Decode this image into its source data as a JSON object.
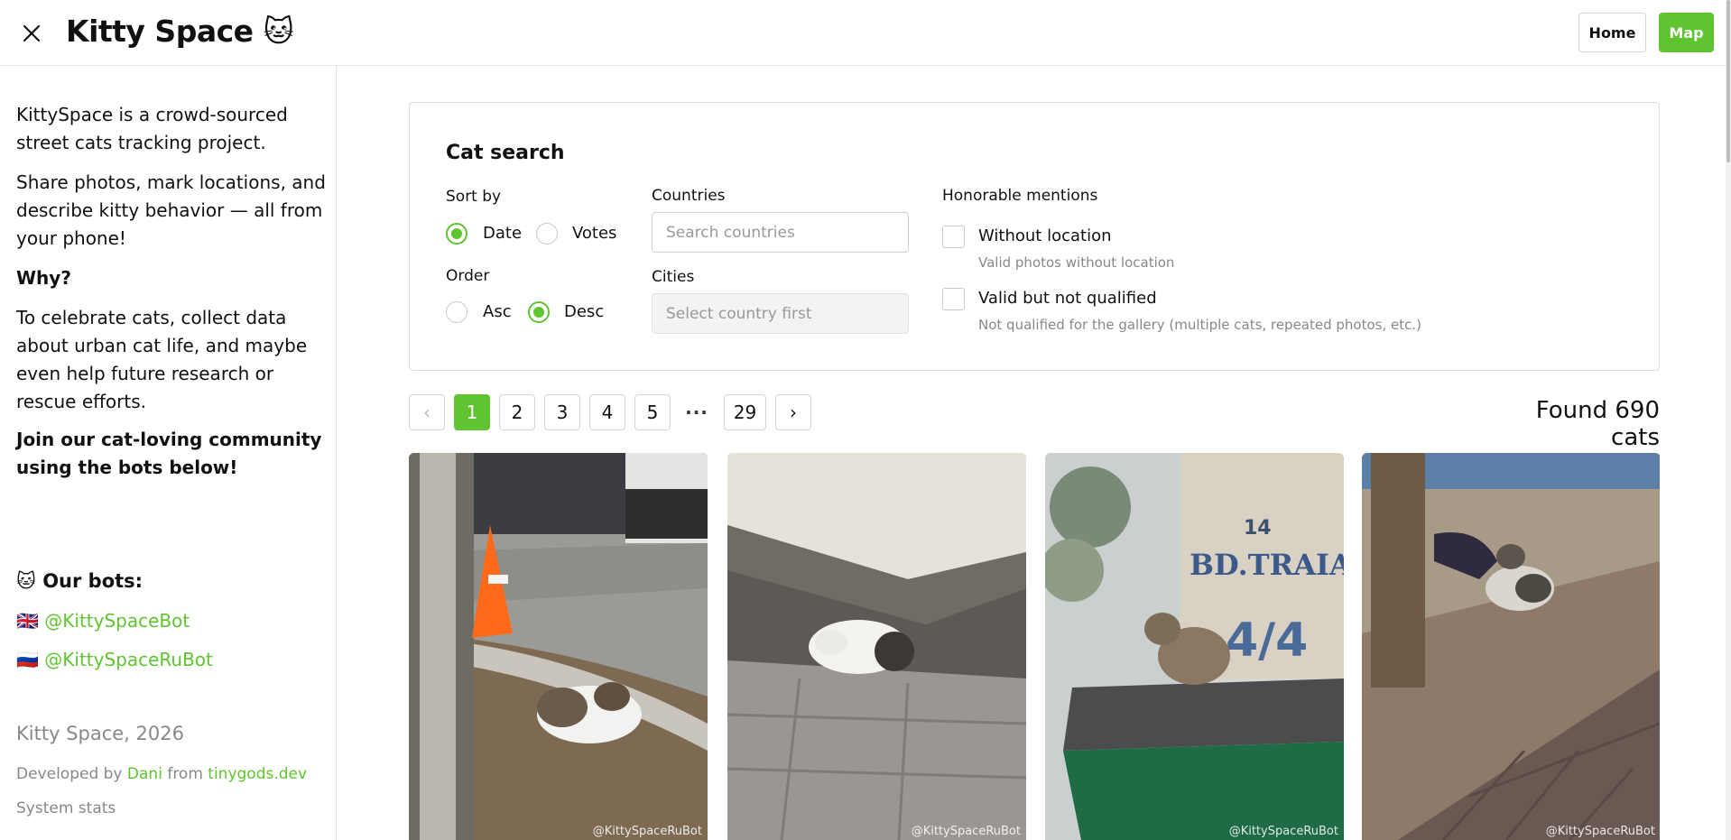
{
  "header": {
    "title": "Kitty Space 🐱",
    "home_label": "Home",
    "map_label": "Map"
  },
  "sidebar": {
    "intro": "KittySpace is a crowd-sourced street cats tracking project.",
    "share": "Share photos, mark locations, and describe kitty behavior — all from your phone!",
    "why_heading": "Why?",
    "why_text": "To celebrate cats, collect data about urban cat life, and maybe even help future research or rescue efforts.",
    "join": "Join our cat-loving community using the bots below!",
    "bots_heading": "🐱 Our bots:",
    "bots": [
      {
        "flag": "🇬🇧",
        "handle": "@KittySpaceBot"
      },
      {
        "flag": "🇷🇺",
        "handle": "@KittySpaceRuBot"
      }
    ],
    "footer": {
      "title": "Kitty Space, 2026",
      "developed_by": "Developed by",
      "developer": "Dani",
      "from": "from",
      "site": "tinygods.dev",
      "stats": "System stats"
    }
  },
  "search": {
    "title": "Cat search",
    "sort_by_label": "Sort by",
    "sort_options": [
      {
        "label": "Date",
        "selected": true
      },
      {
        "label": "Votes",
        "selected": false
      }
    ],
    "order_label": "Order",
    "order_options": [
      {
        "label": "Asc",
        "selected": false
      },
      {
        "label": "Desc",
        "selected": true
      }
    ],
    "countries_label": "Countries",
    "countries_placeholder": "Search countries",
    "cities_label": "Cities",
    "cities_placeholder": "Select country first",
    "honorable_label": "Honorable mentions",
    "honorable": [
      {
        "label": "Without location",
        "description": "Valid photos without location",
        "checked": false
      },
      {
        "label": "Valid but not qualified",
        "description": "Not qualified for the gallery (multiple cats, repeated photos, etc.)",
        "checked": false
      }
    ]
  },
  "pagination": {
    "prev": "‹",
    "pages": [
      "1",
      "2",
      "3",
      "4",
      "5"
    ],
    "ellipsis": "···",
    "last": "29",
    "next": "›",
    "current": 1
  },
  "results": {
    "found_text": "Found 690 cats"
  },
  "photos": [
    {
      "watermark": "@KittySpaceRuBot"
    },
    {
      "watermark": "@KittySpaceRuBot"
    },
    {
      "watermark": "@KittySpaceRuBot"
    },
    {
      "watermark": "@KittySpaceRuBot"
    }
  ],
  "colors": {
    "accent": "#5fc430",
    "muted": "#888888",
    "border": "#dedede"
  }
}
